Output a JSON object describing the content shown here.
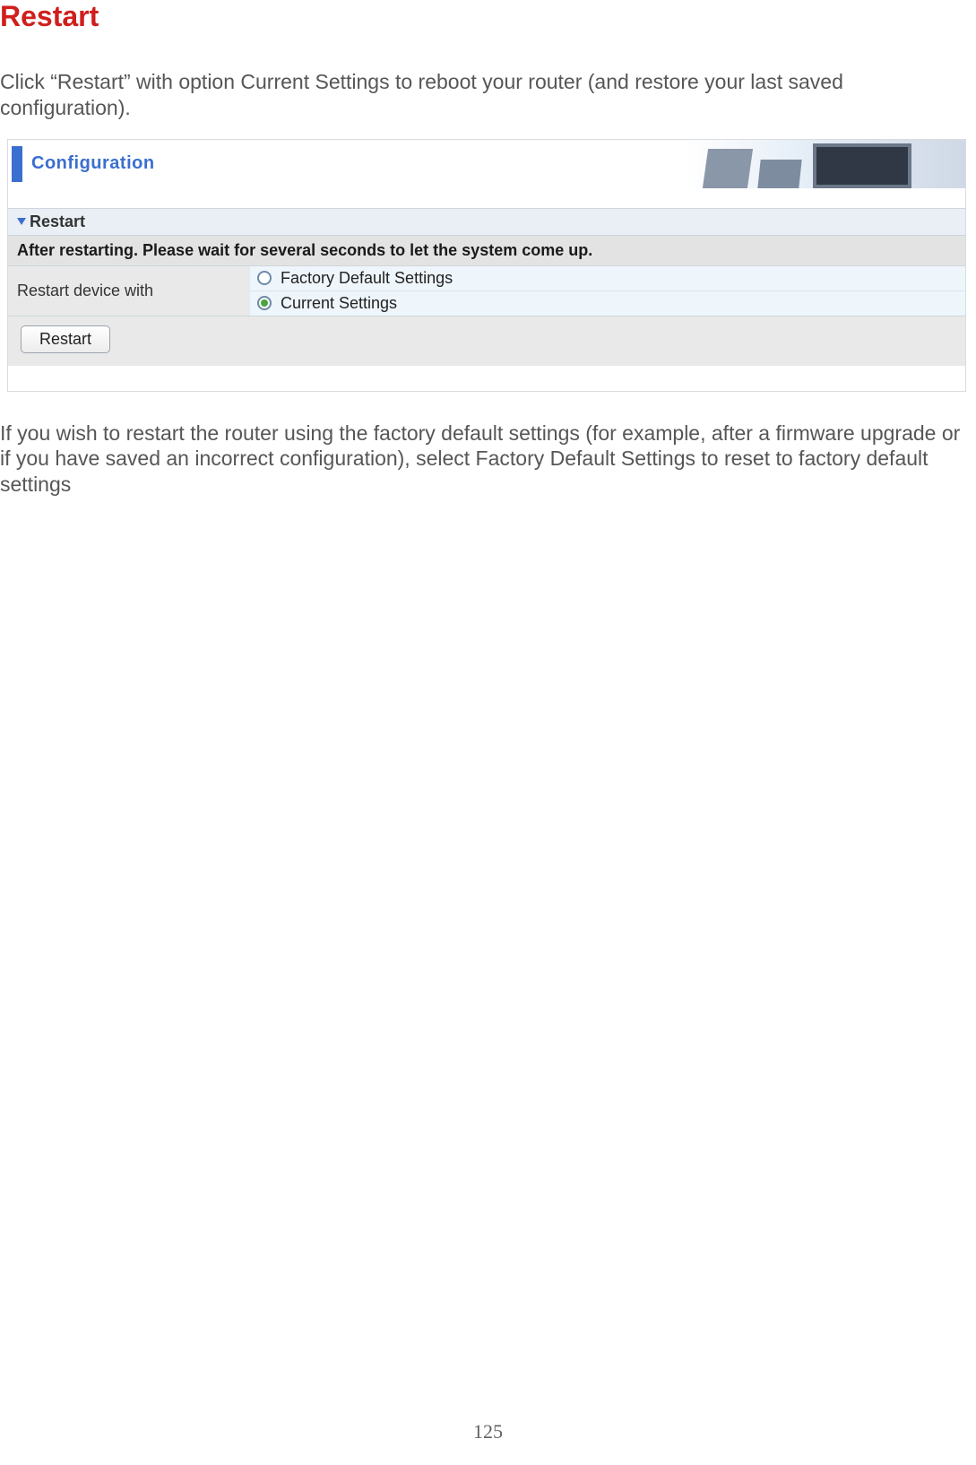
{
  "heading": "Restart",
  "intro_text": "Click “Restart” with option Current Settings to reboot your router (and restore your last saved configuration).",
  "screenshot": {
    "header_title": "Configuration",
    "section_title": "Restart",
    "notice": "After restarting. Please wait for several seconds to let the system come up.",
    "form_label": "Restart device with",
    "options": {
      "factory": "Factory Default Settings",
      "current": "Current Settings"
    },
    "selected_option": "current",
    "button_label": "Restart"
  },
  "outro_text": "If you wish to restart the router using the factory default settings (for example, after a firmware upgrade or if you have saved an incorrect configuration), select Factory Default Settings to reset to factory default settings",
  "page_number": "125"
}
